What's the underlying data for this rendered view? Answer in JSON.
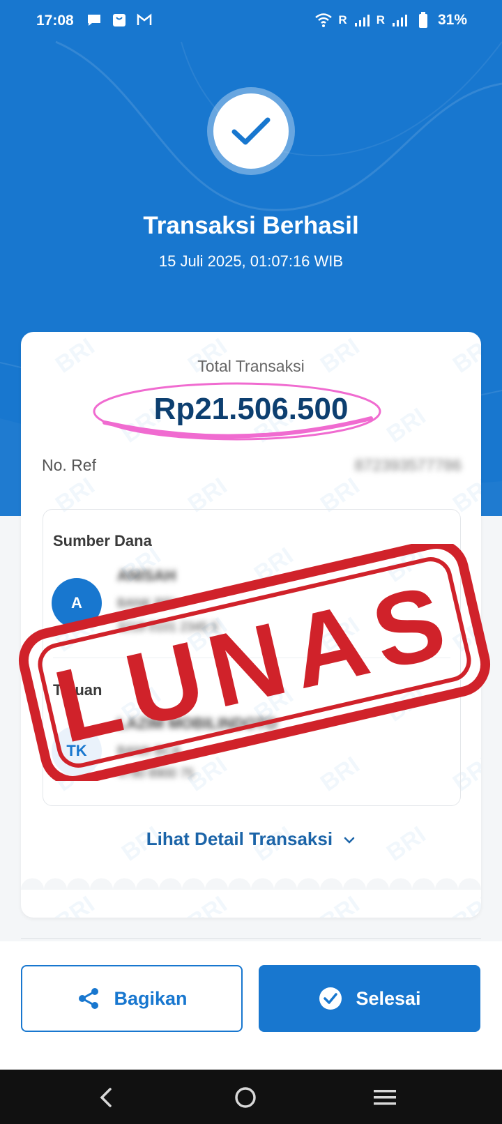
{
  "status_bar": {
    "time": "17:08",
    "signal_label_1": "R",
    "signal_label_2": "R",
    "battery": "31%"
  },
  "header": {
    "title": "Transaksi Berhasil",
    "datetime": "15 Juli 2025, 01:07:16 WIB",
    "icon": "check-icon"
  },
  "summary": {
    "total_label": "Total Transaksi",
    "total_amount": "Rp21.506.500",
    "ref_label": "No. Ref",
    "ref_value": "872393577786"
  },
  "source": {
    "label": "Sumber Dana",
    "avatar": "A",
    "name": "ANISAH",
    "bank": "BANK BRI",
    "account": "3218 0101 2345 5"
  },
  "destination": {
    "label": "Tujuan",
    "avatar": "TK",
    "name": "LAZIM MOBILINDOTO",
    "bank": "BANK BCA",
    "account": "4790 8900 75"
  },
  "stamp_text": "LUNAS",
  "watermark_text": "BRI",
  "detail_link": "Lihat Detail Transaksi",
  "buttons": {
    "share": "Bagikan",
    "done": "Selesai"
  },
  "colors": {
    "primary": "#1877cf",
    "amount": "#0d3f70",
    "stamp": "#d0222a",
    "highlight": "#f06bd0"
  }
}
